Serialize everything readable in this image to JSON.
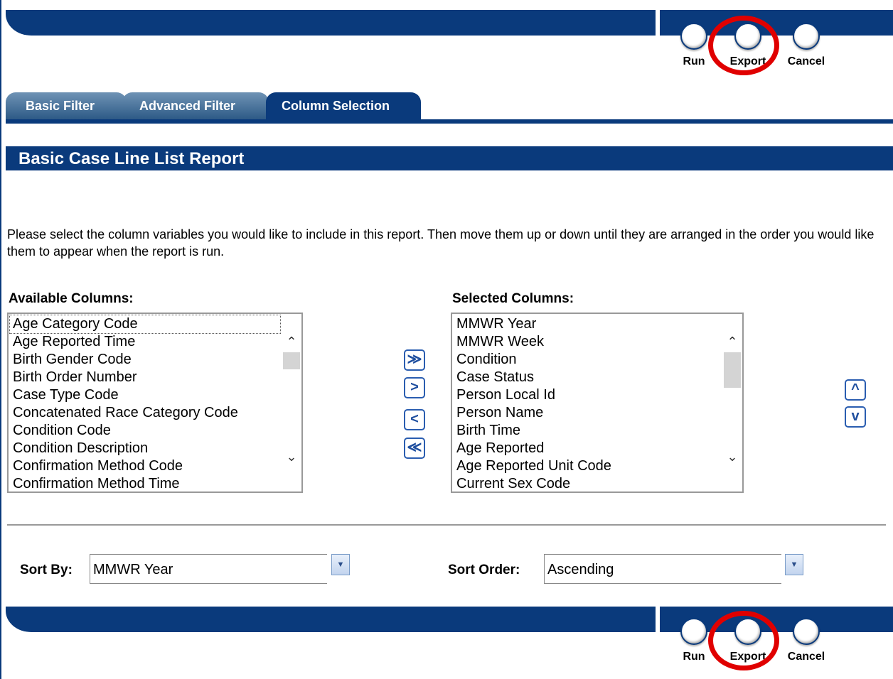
{
  "toolbar_top": {
    "run": "Run",
    "export": "Export",
    "cancel": "Cancel"
  },
  "toolbar_bottom": {
    "run": "Run",
    "export": "Export",
    "cancel": "Cancel"
  },
  "tabs": [
    {
      "label": "Basic Filter",
      "active": false
    },
    {
      "label": "Advanced Filter",
      "active": false
    },
    {
      "label": "Column Selection",
      "active": true
    }
  ],
  "page_title": "Basic Case Line List Report",
  "instructions": "Please select the column variables you would like to include in this report. Then move them up or down until they are arranged in the order you would like them to appear when the report is run.",
  "available": {
    "title": "Available Columns:",
    "items": [
      "Age Category Code",
      "Age Reported Time",
      "Birth Gender Code",
      "Birth Order Number",
      "Case Type Code",
      "Concatenated Race Category Code",
      "Condition Code",
      "Condition Description",
      "Confirmation Method Code",
      "Confirmation Method Time"
    ]
  },
  "selected": {
    "title": "Selected Columns:",
    "items": [
      "MMWR Year",
      "MMWR Week",
      "Condition",
      "Case Status",
      "Person Local Id",
      "Person Name",
      "Birth Time",
      "Age Reported",
      "Age Reported Unit Code",
      "Current Sex Code"
    ]
  },
  "move_buttons": {
    "add_all": "≫",
    "add": ">",
    "remove": "<",
    "remove_all": "≪",
    "up": "^",
    "down": "v"
  },
  "sort": {
    "by_label": "Sort By:",
    "by_value": "MMWR Year",
    "order_label": "Sort Order:",
    "order_value": "Ascending"
  },
  "colors": {
    "navy": "#0a3a7c",
    "highlight_ring": "#e00000"
  }
}
